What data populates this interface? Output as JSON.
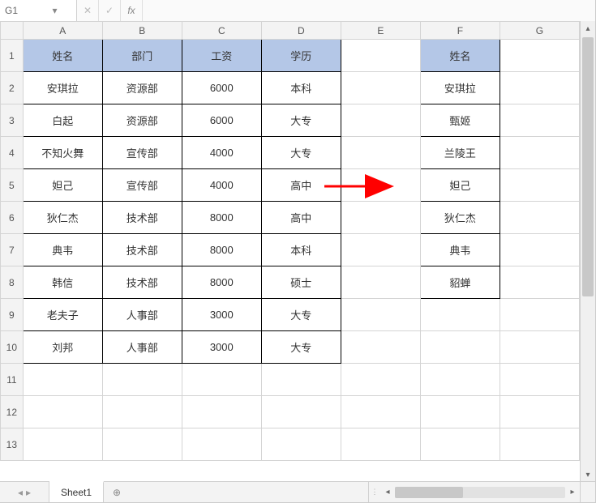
{
  "formula_bar": {
    "cell_ref": "G1",
    "formula": ""
  },
  "columns": [
    "A",
    "B",
    "C",
    "D",
    "E",
    "F",
    "G"
  ],
  "visible_rows": 13,
  "main_table": {
    "headers": [
      "姓名",
      "部门",
      "工资",
      "学历"
    ],
    "rows": [
      [
        "安琪拉",
        "资源部",
        "6000",
        "本科"
      ],
      [
        "白起",
        "资源部",
        "6000",
        "大专"
      ],
      [
        "不知火舞",
        "宣传部",
        "4000",
        "大专"
      ],
      [
        "妲己",
        "宣传部",
        "4000",
        "高中"
      ],
      [
        "狄仁杰",
        "技术部",
        "8000",
        "高中"
      ],
      [
        "典韦",
        "技术部",
        "8000",
        "本科"
      ],
      [
        "韩信",
        "技术部",
        "8000",
        "硕士"
      ],
      [
        "老夫子",
        "人事部",
        "3000",
        "大专"
      ],
      [
        "刘邦",
        "人事部",
        "3000",
        "大专"
      ]
    ]
  },
  "side_list": {
    "header": "姓名",
    "values": [
      "安琪拉",
      "甄姬",
      "兰陵王",
      "妲己",
      "狄仁杰",
      "典韦",
      "貂蝉"
    ]
  },
  "arrow": {
    "color": "#ff0000"
  },
  "tabs": {
    "active": "Sheet1"
  },
  "icons": {
    "dropdown": "▾",
    "cancel": "✕",
    "confirm": "✓",
    "fx": "fx",
    "nav_prev": "◂",
    "nav_next": "▸",
    "add": "⊕",
    "vsep": "⋮",
    "up": "▴",
    "down": "▾",
    "left": "◂",
    "right": "▸"
  }
}
